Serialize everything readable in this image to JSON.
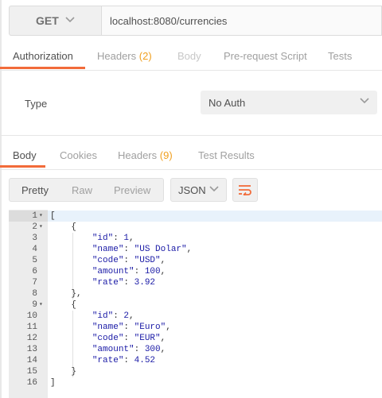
{
  "request": {
    "method": "GET",
    "url": "localhost:8080/currencies"
  },
  "request_tabs": [
    {
      "label": "Authorization",
      "count": "",
      "state": "active"
    },
    {
      "label": "Headers",
      "count": "(2)",
      "state": "normal"
    },
    {
      "label": "Body",
      "count": "",
      "state": "disabled"
    },
    {
      "label": "Pre-request Script",
      "count": "",
      "state": "normal"
    },
    {
      "label": "Tests",
      "count": "",
      "state": "normal"
    }
  ],
  "auth": {
    "type_label": "Type",
    "selected": "No Auth"
  },
  "response_tabs": [
    {
      "label": "Body",
      "count": "",
      "state": "active"
    },
    {
      "label": "Cookies",
      "count": "",
      "state": "normal"
    },
    {
      "label": "Headers",
      "count": "(9)",
      "state": "normal"
    },
    {
      "label": "Test Results",
      "count": "",
      "state": "normal"
    }
  ],
  "view_modes": [
    "Pretty",
    "Raw",
    "Preview"
  ],
  "active_view": "Pretty",
  "format": "JSON",
  "icons": {
    "method_dropdown": "chevron-down-icon",
    "auth_dropdown": "chevron-down-icon",
    "format_dropdown": "chevron-down-icon",
    "wrap": "wrap-lines-icon"
  },
  "colors": {
    "accent": "#f26b3a",
    "count": "#f0a020",
    "string": "#1a1aa6"
  },
  "code_lines": [
    {
      "n": "1",
      "fold": true,
      "tokens": [
        [
          "punc",
          "["
        ]
      ]
    },
    {
      "n": "2",
      "fold": true,
      "tokens": [
        [
          "punc",
          "    {"
        ]
      ]
    },
    {
      "n": "3",
      "fold": false,
      "tokens": [
        [
          "punc",
          "        "
        ],
        [
          "str",
          "\"id\""
        ],
        [
          "punc",
          ": "
        ],
        [
          "num",
          "1"
        ],
        [
          "punc",
          ","
        ]
      ]
    },
    {
      "n": "4",
      "fold": false,
      "tokens": [
        [
          "punc",
          "        "
        ],
        [
          "str",
          "\"name\""
        ],
        [
          "punc",
          ": "
        ],
        [
          "str",
          "\"US Dolar\""
        ],
        [
          "punc",
          ","
        ]
      ]
    },
    {
      "n": "5",
      "fold": false,
      "tokens": [
        [
          "punc",
          "        "
        ],
        [
          "str",
          "\"code\""
        ],
        [
          "punc",
          ": "
        ],
        [
          "str",
          "\"USD\""
        ],
        [
          "punc",
          ","
        ]
      ]
    },
    {
      "n": "6",
      "fold": false,
      "tokens": [
        [
          "punc",
          "        "
        ],
        [
          "str",
          "\"amount\""
        ],
        [
          "punc",
          ": "
        ],
        [
          "num",
          "100"
        ],
        [
          "punc",
          ","
        ]
      ]
    },
    {
      "n": "7",
      "fold": false,
      "tokens": [
        [
          "punc",
          "        "
        ],
        [
          "str",
          "\"rate\""
        ],
        [
          "punc",
          ": "
        ],
        [
          "num",
          "3.92"
        ]
      ]
    },
    {
      "n": "8",
      "fold": false,
      "tokens": [
        [
          "punc",
          "    },"
        ]
      ]
    },
    {
      "n": "9",
      "fold": true,
      "tokens": [
        [
          "punc",
          "    {"
        ]
      ]
    },
    {
      "n": "10",
      "fold": false,
      "tokens": [
        [
          "punc",
          "        "
        ],
        [
          "str",
          "\"id\""
        ],
        [
          "punc",
          ": "
        ],
        [
          "num",
          "2"
        ],
        [
          "punc",
          ","
        ]
      ]
    },
    {
      "n": "11",
      "fold": false,
      "tokens": [
        [
          "punc",
          "        "
        ],
        [
          "str",
          "\"name\""
        ],
        [
          "punc",
          ": "
        ],
        [
          "str",
          "\"Euro\""
        ],
        [
          "punc",
          ","
        ]
      ]
    },
    {
      "n": "12",
      "fold": false,
      "tokens": [
        [
          "punc",
          "        "
        ],
        [
          "str",
          "\"code\""
        ],
        [
          "punc",
          ": "
        ],
        [
          "str",
          "\"EUR\""
        ],
        [
          "punc",
          ","
        ]
      ]
    },
    {
      "n": "13",
      "fold": false,
      "tokens": [
        [
          "punc",
          "        "
        ],
        [
          "str",
          "\"amount\""
        ],
        [
          "punc",
          ": "
        ],
        [
          "num",
          "300"
        ],
        [
          "punc",
          ","
        ]
      ]
    },
    {
      "n": "14",
      "fold": false,
      "tokens": [
        [
          "punc",
          "        "
        ],
        [
          "str",
          "\"rate\""
        ],
        [
          "punc",
          ": "
        ],
        [
          "num",
          "4.52"
        ]
      ]
    },
    {
      "n": "15",
      "fold": false,
      "tokens": [
        [
          "punc",
          "    }"
        ]
      ]
    },
    {
      "n": "16",
      "fold": false,
      "tokens": [
        [
          "punc",
          "]"
        ]
      ]
    }
  ]
}
